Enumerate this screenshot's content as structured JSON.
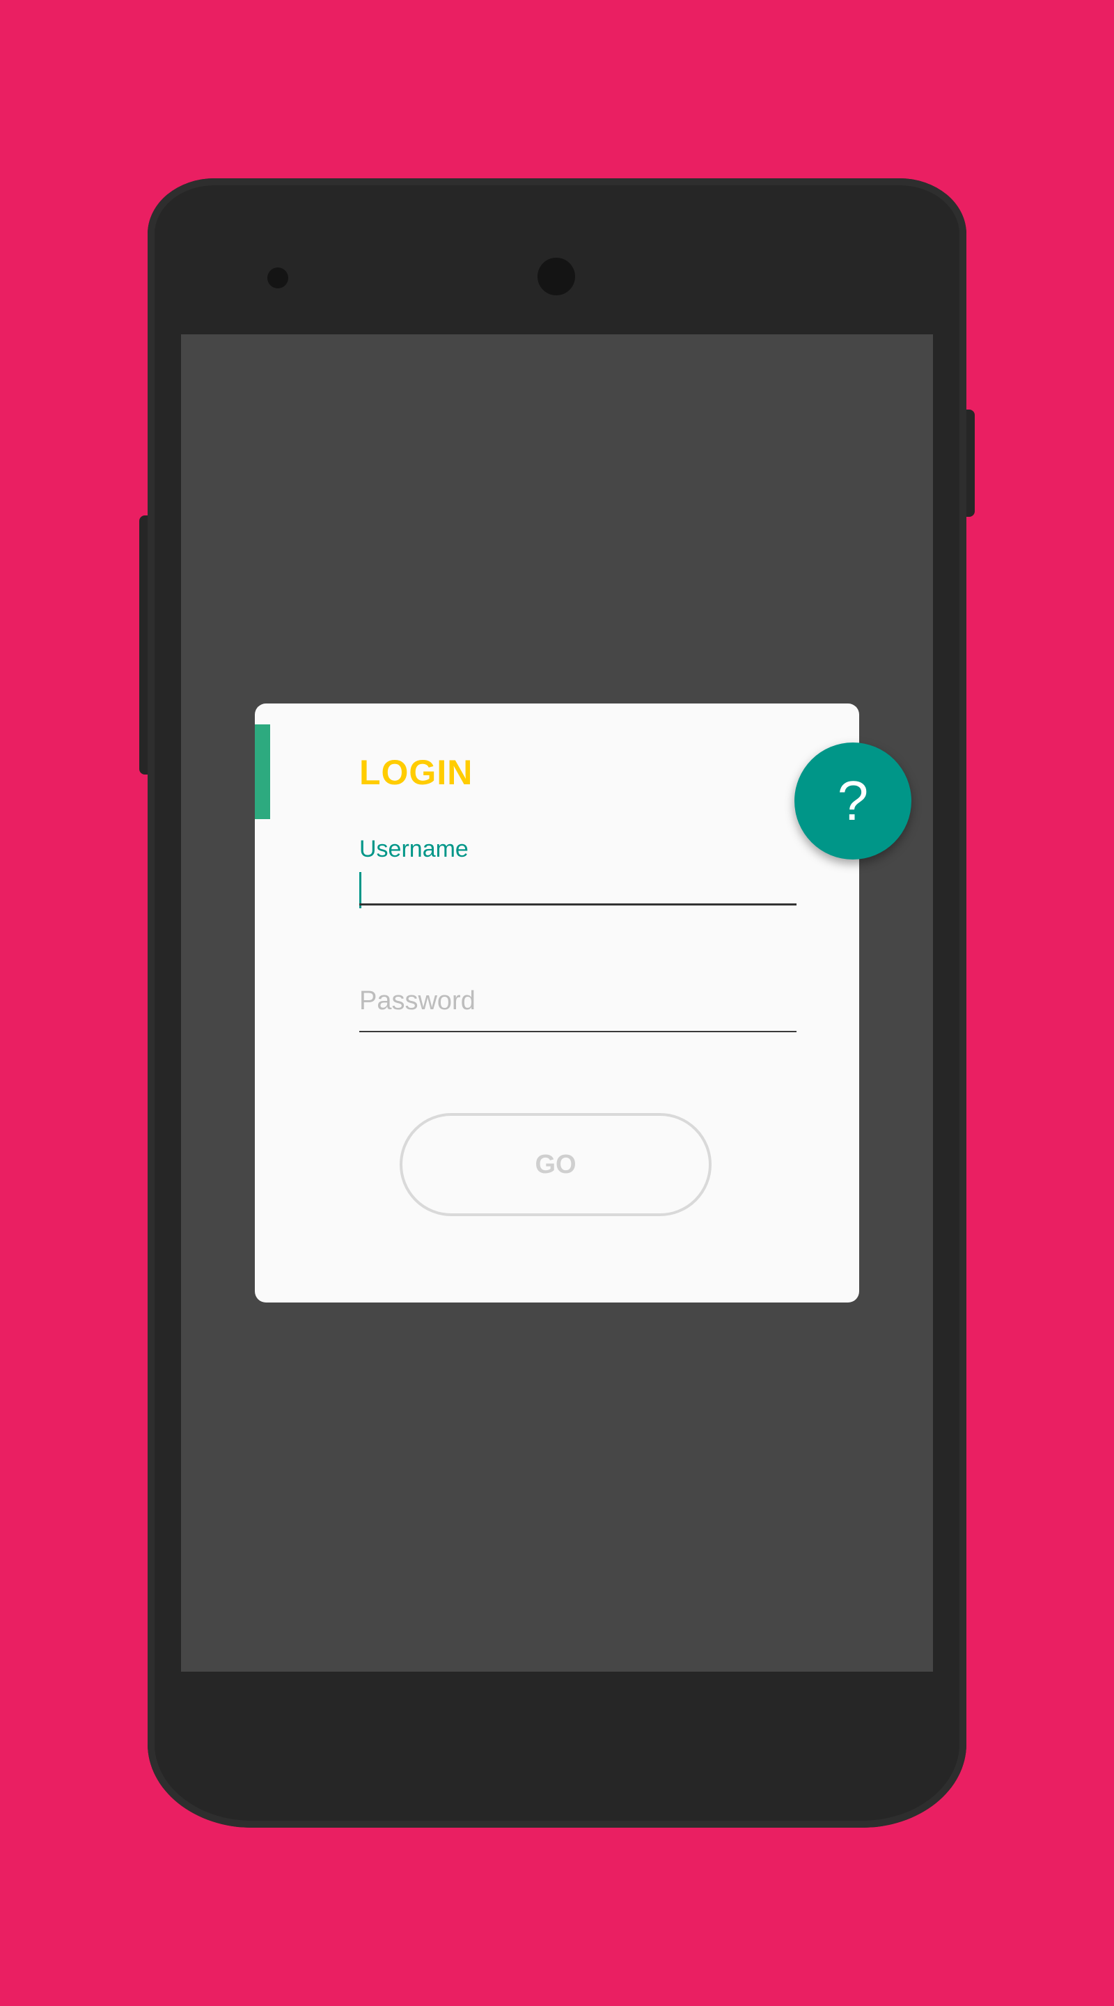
{
  "login": {
    "title": "LOGIN",
    "username_label": "Username",
    "username_value": "",
    "password_placeholder": "Password",
    "go_label": "GO"
  },
  "fab": {
    "icon": "help-question-icon",
    "glyph": "?"
  },
  "colors": {
    "background": "#E91E63",
    "accent": "#009688",
    "title": "#FFCC00",
    "accent_bar": "#2DAA7F"
  }
}
